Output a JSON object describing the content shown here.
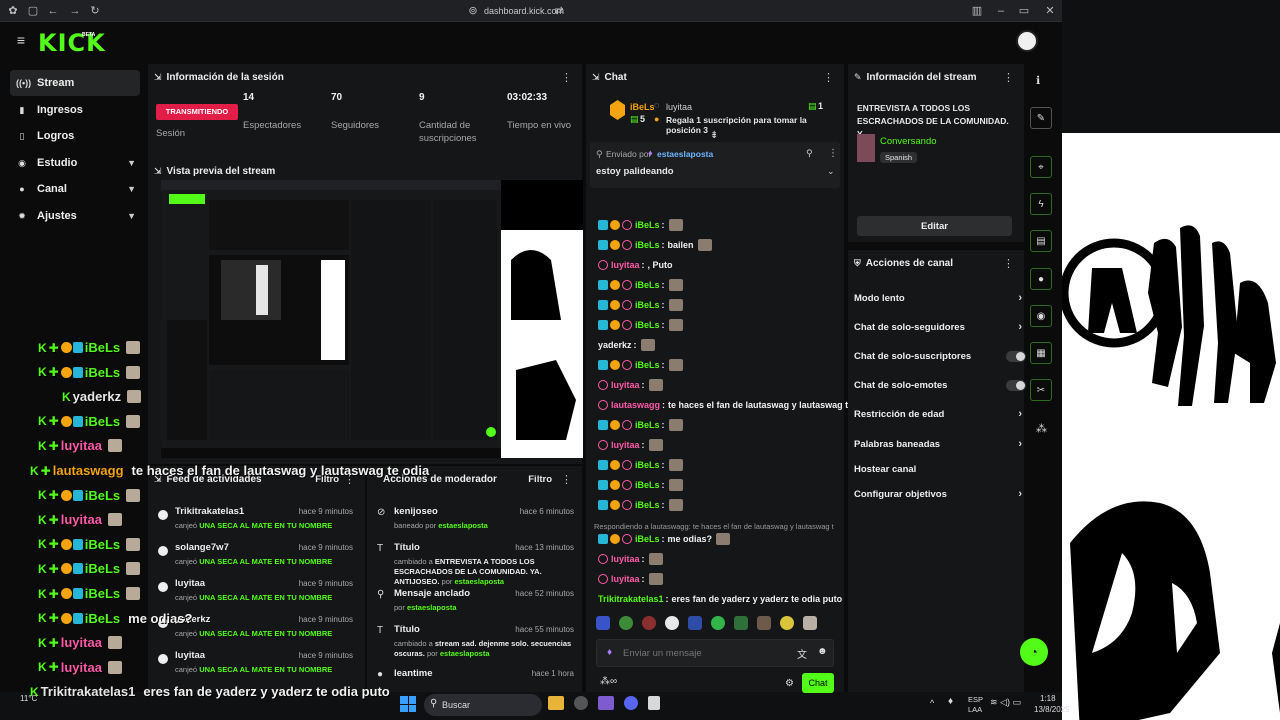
{
  "browser": {
    "url": "dashboard.kick.com"
  },
  "app": {
    "logo": "KICK",
    "logo_badge": "BETA"
  },
  "sidebar": {
    "items": [
      {
        "label": "Stream",
        "icon": "broadcast-icon"
      },
      {
        "label": "Ingresos",
        "icon": "chart-icon"
      },
      {
        "label": "Logros",
        "icon": "trophy-icon"
      },
      {
        "label": "Estudio",
        "icon": "studio-icon"
      },
      {
        "label": "Canal",
        "icon": "user-icon"
      },
      {
        "label": "Ajustes",
        "icon": "gear-icon"
      }
    ]
  },
  "session": {
    "title": "Información de la sesión",
    "status_badge": "TRANSMITIENDO",
    "status_label": "Sesión",
    "stats": [
      {
        "value": "14",
        "label": "Espectadores"
      },
      {
        "value": "70",
        "label": "Seguidores"
      },
      {
        "value": "9",
        "label": "Cantidad de suscripciones"
      },
      {
        "value": "03:02:33",
        "label": "Tiempo en vivo"
      }
    ]
  },
  "preview": {
    "title": "Vista previa del stream"
  },
  "activity": {
    "title": "Feed de actividades",
    "filter": "Filtro",
    "items": [
      {
        "name": "Trikitrakatelas1",
        "time": "hace 9 minutos",
        "verb": "canjeó",
        "reward": "UNA SECA AL MATE EN TU NOMBRE"
      },
      {
        "name": "solange7w7",
        "time": "hace 9 minutos",
        "verb": "canjeó",
        "reward": "UNA SECA AL MATE EN TU NOMBRE"
      },
      {
        "name": "luyitaa",
        "time": "hace 9 minutos",
        "verb": "canjeó",
        "reward": "UNA SECA AL MATE EN TU NOMBRE"
      },
      {
        "name": "yaderkz",
        "time": "hace 9 minutos",
        "verb": "canjeó",
        "reward": "UNA SECA AL MATE EN TU NOMBRE"
      },
      {
        "name": "luyitaa",
        "time": "hace 9 minutos",
        "verb": "canjeó",
        "reward": "UNA SECA AL MATE EN TU NOMBRE"
      }
    ]
  },
  "moderation": {
    "title": "Acciones de moderador",
    "filter": "Filtro",
    "items": [
      {
        "name": "kenijoseo",
        "time": "hace 6 minutos",
        "desc_prefix": "baneado por",
        "desc_bold": "",
        "by": "estaeslaposta",
        "icon": "ban-icon"
      },
      {
        "name": "Título",
        "time": "hace 13 minutos",
        "desc_prefix": "cambiado a",
        "desc_bold": "ENTREVISTA A TODOS LOS ESCRACHADOS DE LA COMUNIDAD. YA. ANTIJOSEO.",
        "by_prefix": "por",
        "by": "estaeslaposta",
        "icon": "title-icon"
      },
      {
        "name": "Mensaje anclado",
        "time": "hace 52 minutos",
        "desc_prefix": "por",
        "desc_bold": "",
        "by": "estaeslaposta",
        "icon": "pin-icon"
      },
      {
        "name": "Título",
        "time": "hace 55 minutos",
        "desc_prefix": "cambiado a",
        "desc_bold": "stream sad. dejenme solo. secuencias oscuras.",
        "by_prefix": "por",
        "by": "estaeslaposta",
        "icon": "title-icon"
      },
      {
        "name": "leantime",
        "time": "hace 1 hora",
        "desc_prefix": "",
        "desc_bold": "",
        "by": "",
        "icon": "user-icon"
      }
    ]
  },
  "chat": {
    "title": "Chat",
    "top_gifter": {
      "name": "iBeLs",
      "count": "5",
      "other_user": "luyitaa",
      "count2": "1",
      "promo": "Regala 1 suscripción para tomar la posición 3"
    },
    "pinned": {
      "label": "Enviado por",
      "by": "estaeslaposta",
      "message": "estoy palideando"
    },
    "reply_context": "Respondiendo a lautaswagg: te haces el fan de lautaswag y lautaswag te odia",
    "messages": [
      {
        "user": "iBeLs",
        "color": "#53fc18",
        "text": "",
        "badges": "full",
        "emote": true
      },
      {
        "user": "iBeLs",
        "color": "#53fc18",
        "text": "bailen",
        "badges": "full",
        "emote": true
      },
      {
        "user": "luyitaa",
        "color": "#ff5aa8",
        "text": ", Puto",
        "badges": "p",
        "emote": false
      },
      {
        "user": "iBeLs",
        "color": "#53fc18",
        "text": "",
        "badges": "full",
        "emote": true
      },
      {
        "user": "iBeLs",
        "color": "#53fc18",
        "text": "",
        "badges": "full",
        "emote": true
      },
      {
        "user": "iBeLs",
        "color": "#53fc18",
        "text": "",
        "badges": "full",
        "emote": true
      },
      {
        "user": "yaderkz",
        "color": "#f1f1f1",
        "text": "",
        "badges": "none",
        "emote": true
      },
      {
        "user": "iBeLs",
        "color": "#53fc18",
        "text": "",
        "badges": "full",
        "emote": true
      },
      {
        "user": "luyitaa",
        "color": "#ff5aa8",
        "text": "",
        "badges": "p",
        "emote": true
      },
      {
        "user": "lautaswagg",
        "color": "#ff5aa8",
        "text": "te haces el fan de lautaswag y lautaswag te odia",
        "badges": "p",
        "emote": false
      },
      {
        "user": "iBeLs",
        "color": "#53fc18",
        "text": "",
        "badges": "full",
        "emote": true
      },
      {
        "user": "luyitaa",
        "color": "#ff5aa8",
        "text": "",
        "badges": "p",
        "emote": true
      },
      {
        "user": "iBeLs",
        "color": "#53fc18",
        "text": "",
        "badges": "full",
        "emote": true
      },
      {
        "user": "iBeLs",
        "color": "#53fc18",
        "text": "",
        "badges": "full",
        "emote": true
      },
      {
        "user": "iBeLs",
        "color": "#53fc18",
        "text": "",
        "badges": "full",
        "emote": true
      }
    ],
    "after_reply": [
      {
        "user": "iBeLs",
        "color": "#53fc18",
        "text": "me odias?",
        "badges": "full",
        "emote": true
      },
      {
        "user": "luyitaa",
        "color": "#ff5aa8",
        "text": "",
        "badges": "p",
        "emote": true
      },
      {
        "user": "luyitaa",
        "color": "#ff5aa8",
        "text": "",
        "badges": "p",
        "emote": true
      },
      {
        "user": "Trikitrakatelas1",
        "color": "#53fc18",
        "text": "eres fan de yaderz y yaderz te odia puto",
        "badges": "none",
        "emote": false
      }
    ],
    "input_placeholder": "Enviar un mensaje",
    "send_label": "Chat"
  },
  "stream_info": {
    "title": "Información del stream",
    "stream_title": "ENTREVISTA A TODOS LOS ESCRACHADOS DE LA COMUNIDAD. Y...",
    "category": "Conversando",
    "language": "Spanish",
    "edit_label": "Editar"
  },
  "channel_actions": {
    "title": "Acciones de canal",
    "items": [
      {
        "label": "Modo lento",
        "control": "arrow"
      },
      {
        "label": "Chat de solo-seguidores",
        "control": "arrow"
      },
      {
        "label": "Chat de solo-suscriptores",
        "control": "toggle"
      },
      {
        "label": "Chat de solo-emotes",
        "control": "toggle"
      },
      {
        "label": "Restricción de edad",
        "control": "arrow"
      },
      {
        "label": "Palabras baneadas",
        "control": "arrow"
      },
      {
        "label": "Hostear canal",
        "control": "none"
      },
      {
        "label": "Configurar objetivos",
        "control": "arrow"
      }
    ]
  },
  "overlay_chat": [
    {
      "user": "iBeLs",
      "text": ""
    },
    {
      "user": "iBeLs",
      "text": ""
    },
    {
      "user": "yaderkz",
      "text": ""
    },
    {
      "user": "iBeLs",
      "text": ""
    },
    {
      "user": "luyitaa",
      "text": ""
    },
    {
      "user": "lautaswagg",
      "text": "te haces el fan de lautaswag y lautaswag te odia"
    },
    {
      "user": "iBeLs",
      "text": ""
    },
    {
      "user": "luyitaa",
      "text": ""
    },
    {
      "user": "iBeLs",
      "text": ""
    },
    {
      "user": "iBeLs",
      "text": ""
    },
    {
      "user": "iBeLs",
      "text": ""
    },
    {
      "user": "iBeLs",
      "text": "me odias?"
    },
    {
      "user": "luyitaa",
      "text": ""
    },
    {
      "user": "luyitaa",
      "text": ""
    },
    {
      "user": "Trikitrakatelas1",
      "text": "eres fan de yaderz y yaderz te odia puto"
    }
  ],
  "taskbar": {
    "weather": "11°C",
    "search_label": "Buscar",
    "lang": "ESP",
    "lang2": "LAA",
    "time": "1:18",
    "date": "13/8/2025"
  }
}
